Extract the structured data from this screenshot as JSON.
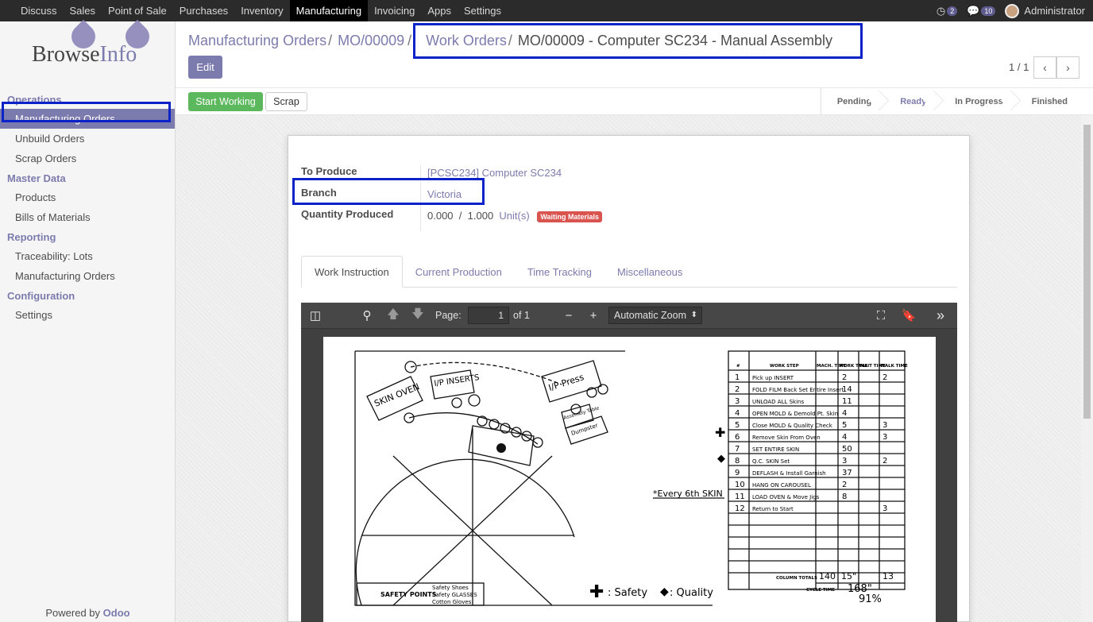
{
  "topbar": {
    "menu": [
      "Discuss",
      "Sales",
      "Point of Sale",
      "Purchases",
      "Inventory",
      "Manufacturing",
      "Invoicing",
      "Apps",
      "Settings"
    ],
    "active": "Manufacturing",
    "activity_count": "2",
    "messages_count": "10",
    "user": "Administrator"
  },
  "logo": {
    "part1": "Browse",
    "part2": "Info"
  },
  "sidebar": {
    "sections": [
      {
        "title": "Operations",
        "items": [
          "Manufacturing Orders",
          "Unbuild Orders",
          "Scrap Orders"
        ]
      },
      {
        "title": "Master Data",
        "items": [
          "Products",
          "Bills of Materials"
        ]
      },
      {
        "title": "Reporting",
        "items": [
          "Traceability: Lots",
          "Manufacturing Orders"
        ]
      },
      {
        "title": "Configuration",
        "items": [
          "Settings"
        ]
      }
    ],
    "powered_prefix": "Powered by",
    "powered_brand": "Odoo"
  },
  "breadcrumb": {
    "items": [
      "Manufacturing Orders",
      "MO/00009",
      "Work Orders"
    ],
    "current": "MO/00009 - Computer SC234 - Manual Assembly",
    "separator": "/"
  },
  "buttons": {
    "edit": "Edit",
    "start": "Start Working",
    "scrap": "Scrap"
  },
  "pager": {
    "value": "1 / 1",
    "prev": "‹",
    "next": "›"
  },
  "stages": [
    "Pending",
    "Ready",
    "In Progress",
    "Finished"
  ],
  "current_stage": "Ready",
  "form": {
    "to_produce_label": "To Produce",
    "to_produce_value": "[PCSC234] Computer SC234",
    "branch_label": "Branch",
    "branch_value": "Victoria",
    "qty_label": "Quantity Produced",
    "qty_done": "0.000",
    "qty_sep": "/",
    "qty_total": "1.000",
    "qty_uom": "Unit(s)",
    "state_badge": "Waiting Materials"
  },
  "tabs": [
    "Work Instruction",
    "Current Production",
    "Time Tracking",
    "Miscellaneous"
  ],
  "pdf": {
    "page_label": "Page:",
    "page_value": "1",
    "page_of": "of 1",
    "zoom": "Automatic Zoom"
  },
  "drawing": {
    "oven": "SKIN OVEN",
    "inserts": "I/P INSERTS",
    "press": "I/P Press",
    "table": "Assembly Table",
    "dumpster": "Dumpster",
    "every": "*Every 6th SKIN",
    "safety_points": "SAFETY POINTS",
    "safety_items": [
      "Safety Shoes",
      "Safety GLASSES",
      "Cotton Gloves"
    ],
    "legend_safety": ": Safety",
    "legend_quality": ": Quality",
    "table_headers": [
      "#",
      "WORK STEP",
      "MACH. TIME",
      "WORK TIME",
      "WAIT TIME",
      "WALK TIME"
    ],
    "steps": [
      [
        "1",
        "Pick up INSERT",
        "",
        "2",
        "",
        "2"
      ],
      [
        "2",
        "FOLD FILM Back Set Entire Insert",
        "",
        "14",
        "",
        ""
      ],
      [
        "3",
        "UNLOAD ALL Skins",
        "",
        "11",
        "",
        ""
      ],
      [
        "4",
        "OPEN MOLD & Demold Pt. Skin",
        "",
        "4",
        "",
        ""
      ],
      [
        "5",
        "Close MOLD & Quality Check",
        "",
        "5",
        "",
        "3"
      ],
      [
        "6",
        "Remove Skin From Oven",
        "",
        "4",
        "",
        "3"
      ],
      [
        "7",
        "SET ENTIRE SKIN",
        "",
        "50",
        "",
        ""
      ],
      [
        "8",
        "Q.C. SKIN Set",
        "",
        "3",
        "",
        "2"
      ],
      [
        "9",
        "DEFLASH & Install Garnish",
        "",
        "37",
        "",
        ""
      ],
      [
        "10",
        "HANG ON CAROUSEL",
        "",
        "2",
        "",
        ""
      ],
      [
        "11",
        "LOAD OVEN & Move Jigs",
        "",
        "8",
        "",
        ""
      ],
      [
        "12",
        "Return to Start",
        "",
        "",
        "",
        "3"
      ]
    ],
    "totals_label": "COLUMN TOTALS",
    "totals": [
      "140",
      "15\"",
      "13"
    ],
    "cycle_label": "CYCLE TIME",
    "cycle_value": "168\"",
    "cycle_pct": "91%"
  }
}
